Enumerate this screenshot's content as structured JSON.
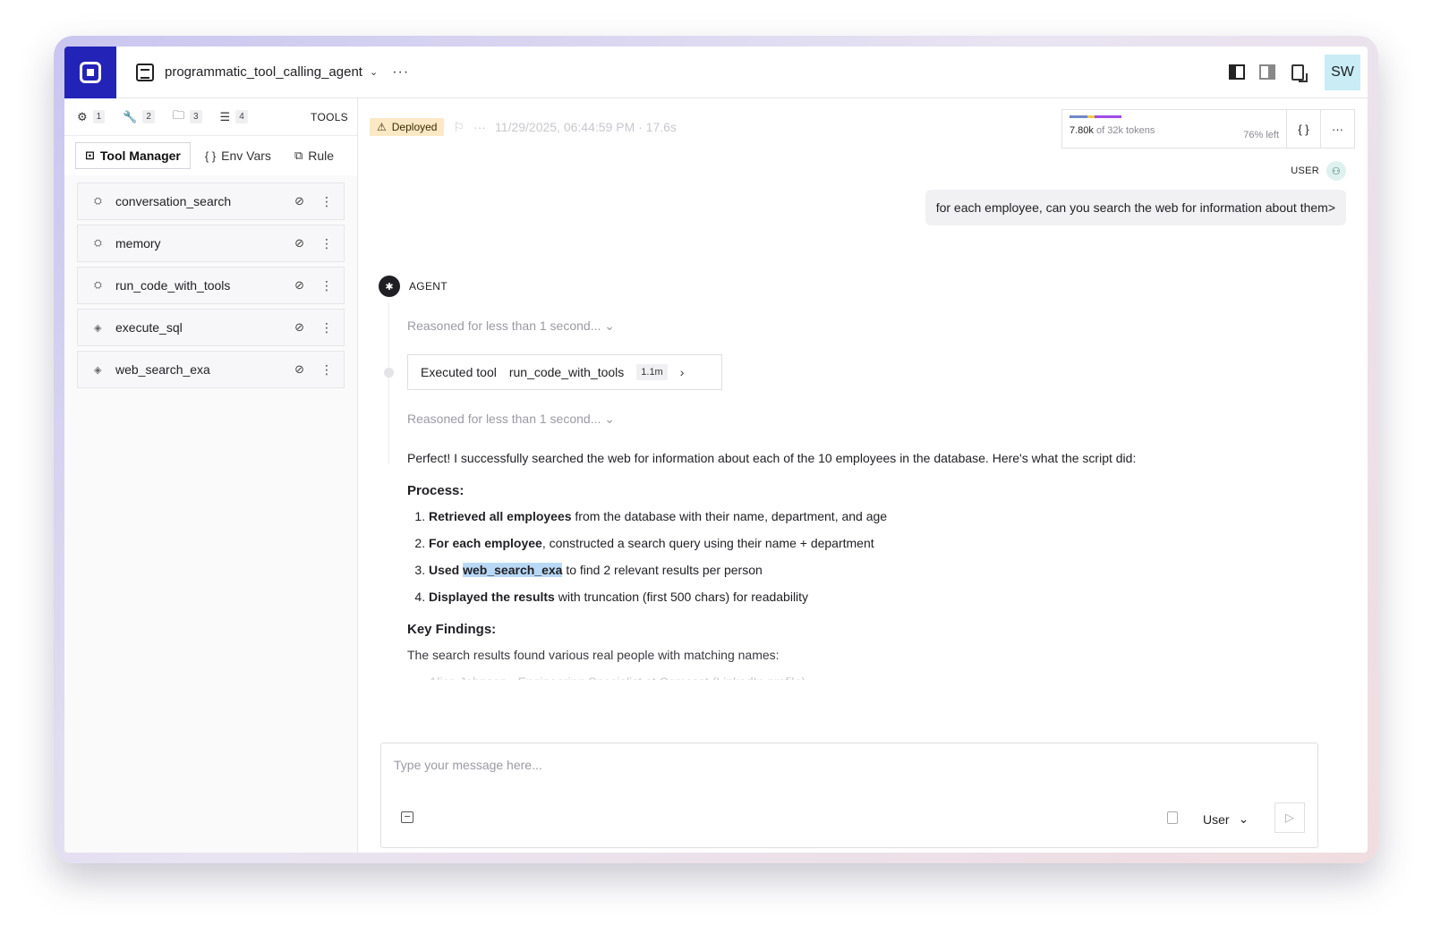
{
  "header": {
    "agent_name": "programmatic_tool_calling_agent",
    "chevron": "⌄",
    "more": "···",
    "avatar_initials": "SW",
    "icons": [
      "logo-icon",
      "agent-icon",
      "layout-left-icon",
      "layout-right-icon",
      "doc-export-icon"
    ]
  },
  "sidebar": {
    "tabs": [
      {
        "icon": "agent-icon",
        "glyph": "⚙",
        "count": "1"
      },
      {
        "icon": "wrench-icon",
        "glyph": "🔧",
        "count": "2"
      },
      {
        "icon": "folder-icon",
        "glyph": "🗀",
        "count": "3"
      },
      {
        "icon": "sliders-icon",
        "glyph": "☰",
        "count": "4"
      }
    ],
    "section_label": "TOOLS",
    "subtabs": [
      {
        "label": "Tool Manager",
        "icon": "folder-edit-icon",
        "glyph": "⊡"
      },
      {
        "label": "Env Vars",
        "icon": "braces-icon",
        "glyph": "{ }"
      },
      {
        "label": "Rule",
        "icon": "rules-icon",
        "glyph": "⧉"
      }
    ],
    "tools": [
      {
        "name": "conversation_search",
        "icon": "builtin-tool-icon"
      },
      {
        "name": "memory",
        "icon": "builtin-tool-icon"
      },
      {
        "name": "run_code_with_tools",
        "icon": "builtin-tool-icon"
      },
      {
        "name": "execute_sql",
        "icon": "custom-tool-icon"
      },
      {
        "name": "web_search_exa",
        "icon": "custom-tool-icon"
      }
    ]
  },
  "status": {
    "badge": "Deployed",
    "badge_icon": "⚠",
    "timestamp": "11/29/2025, 06:44:59 PM · 17.6s"
  },
  "tokens": {
    "used": "7.80k",
    "of_total": "of 32k tokens",
    "left": "76% left",
    "bar_colors": [
      "#6f88c9",
      "#f1c84b",
      "#a24be8"
    ],
    "json_button": "{ }",
    "more_button": "···"
  },
  "conversation": {
    "user_label": "USER",
    "user_message": "for each employee, can you search the web for information about them>",
    "agent_label": "AGENT",
    "reasoning_1": "Reasoned for less than 1 second...",
    "executed_label": "Executed tool",
    "executed_tool": "run_code_with_tools",
    "executed_duration": "1.1m",
    "reasoning_2": "Reasoned for less than 1 second...",
    "reply_intro": "Perfect! I successfully searched the web for information about each of the 10 employees in the database. Here's what the script did:",
    "process_heading": "Process:",
    "steps": [
      {
        "bold": "Retrieved all employees",
        "rest": " from the database with their name, department, and age"
      },
      {
        "bold": "For each employee",
        "rest": ", constructed a search query using their name + department"
      },
      {
        "bold": "Used",
        "code": "web_search_exa",
        "rest": " to find 2 relevant results per person"
      },
      {
        "bold": "Displayed the results",
        "rest": " with truncation (first 500 chars) for readability"
      }
    ],
    "findings_heading": "Key Findings:",
    "findings_text": "The search results found various real people with matching names:",
    "faded_line": "Alice Johnson - Engineering Specialist at Comcast (LinkedIn profile)"
  },
  "composer": {
    "placeholder": "Type your message here...",
    "role": "User",
    "role_chevron": "⌄",
    "send_glyph": "▷"
  }
}
